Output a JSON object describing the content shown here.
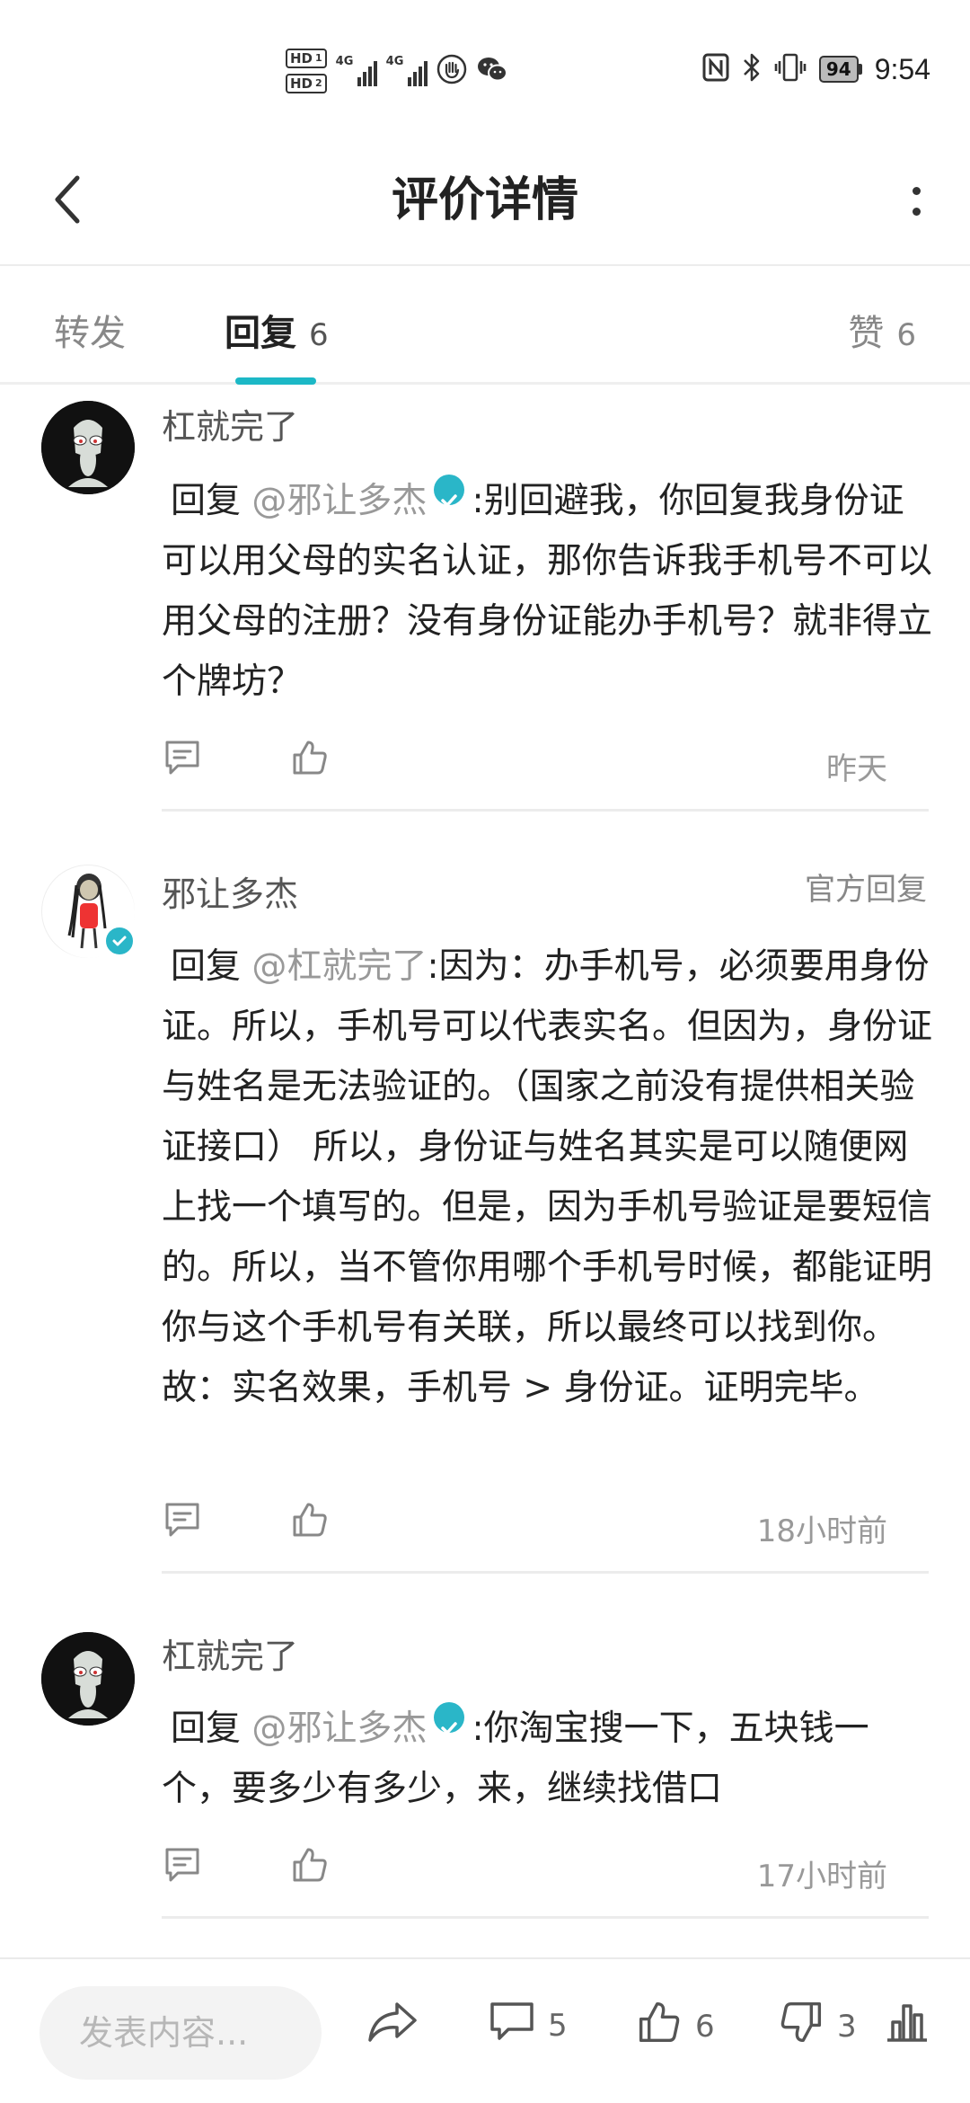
{
  "status_bar": {
    "hd1": "HD",
    "hd1_sub": "1",
    "hd2": "HD",
    "hd2_sub": "2",
    "net1": "4G",
    "net2": "4G",
    "battery": "94",
    "time": "9:54",
    "icons": [
      "hand-icon",
      "wechat-icon",
      "nfc-icon",
      "bluetooth-icon",
      "vibrate-icon"
    ]
  },
  "header": {
    "title": "评价详情"
  },
  "tabs": {
    "forward": {
      "label": "转发"
    },
    "reply": {
      "label": "回复",
      "count": "6"
    },
    "likes": {
      "label": "赞",
      "count": "6"
    }
  },
  "comments": [
    {
      "username": "杠就完了",
      "reply_word": "回复",
      "mention": "@邪让多杰",
      "mention_verified": true,
      "text": ":别回避我，你回复我身份证可以用父母的实名认证，那你告诉我手机号不可以用父母的注册？没有身份证能办手机号？就非得立个牌坊？",
      "time": "昨天"
    },
    {
      "username": "邪让多杰",
      "official_tag": "官方回复",
      "reply_word": "回复",
      "mention": "@杠就完了",
      "text": ":因为：办手机号，必须要用身份证。所以，手机号可以代表实名。但因为，身份证与姓名是无法验证的。（国家之前没有提供相关验证接口） 所以，身份证与姓名其实是可以随便网上找一个填写的。但是，因为手机号验证是要短信的。所以，当不管你用哪个手机号时候，都能证明你与这个手机号有关联，所以最终可以找到你。故：实名效果，手机号 > 身份证。证明完毕。",
      "time": "18小时前"
    },
    {
      "username": "杠就完了",
      "reply_word": "回复",
      "mention": "@邪让多杰",
      "mention_verified": true,
      "text": ":你淘宝搜一下，五块钱一个，要多少有多少，来，继续找借口",
      "time": "17小时前"
    }
  ],
  "bottom_bar": {
    "input_placeholder": "发表内容...",
    "comment_count": "5",
    "like_count": "6",
    "dislike_count": "3"
  },
  "colors": {
    "accent": "#1cb8c6",
    "verified": "#2ab6c8",
    "muted_text": "#999999"
  }
}
